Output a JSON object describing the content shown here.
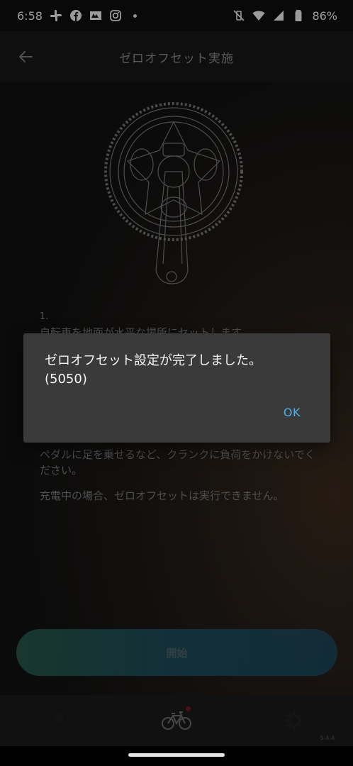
{
  "status_bar": {
    "time": "6:58",
    "battery": "86%",
    "left_icons": [
      "slack-icon",
      "facebook-icon",
      "news-icon",
      "instagram-icon",
      "dot-icon"
    ],
    "right_icons": [
      "vibrate-off-icon",
      "wifi-icon",
      "signal-icon",
      "battery-icon"
    ]
  },
  "header": {
    "title": "ゼロオフセット実施",
    "back_icon": "arrow-left-icon"
  },
  "instructions": {
    "step_number": "1.",
    "step_text": "自転車を地面が水平な場所にセットします。",
    "caution_text": "ペダルに足を乗せるなど、クランクに負荷をかけないでください。",
    "charging_text": "充電中の場合、ゼロオフセットは実行できません。"
  },
  "start_button": {
    "label": "開始"
  },
  "bottom_nav": {
    "items": [
      {
        "icon": "lightbulb-icon"
      },
      {
        "icon": "bicycle-icon",
        "badge": true
      },
      {
        "icon": "gear-icon"
      }
    ]
  },
  "version": "5.4.4",
  "dialog": {
    "message": "ゼロオフセット設定が完了しました。\n(5050)",
    "ok_label": "OK"
  },
  "colors": {
    "accent": "#4fb0e8",
    "dialog_bg": "#3a3a3a",
    "badge": "#d21f2a"
  }
}
